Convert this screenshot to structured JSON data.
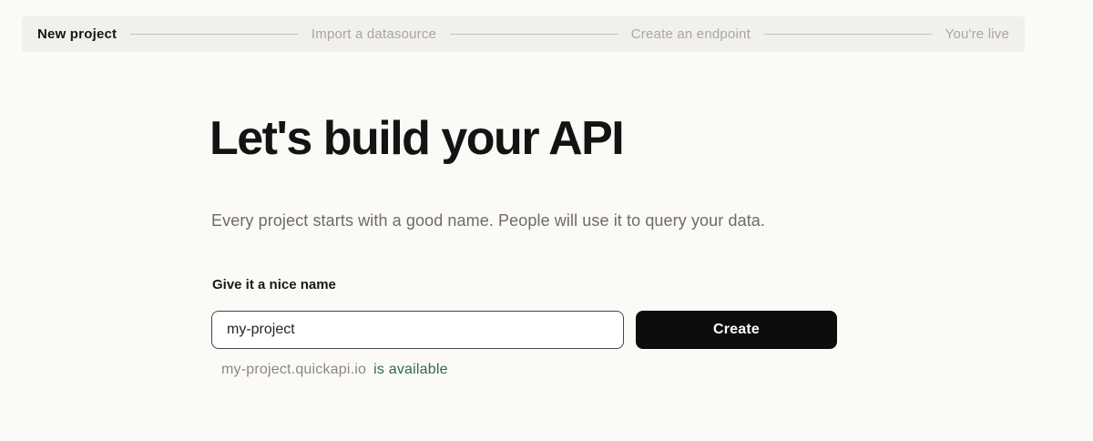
{
  "stepper": {
    "steps": [
      {
        "label": "New project",
        "active": true
      },
      {
        "label": "Import a datasource",
        "active": false
      },
      {
        "label": "Create an endpoint",
        "active": false
      },
      {
        "label": "You're live",
        "active": false
      }
    ]
  },
  "main": {
    "title": "Let's build your API",
    "subtitle": "Every project starts with a good name. People will use it to query your data.",
    "name_label": "Give it a nice name",
    "name_input": {
      "value": "my-project"
    },
    "create_button_label": "Create",
    "availability": {
      "domain": "my-project.quickapi.io",
      "status": "is available"
    }
  },
  "colors": {
    "page_background": "#fbfaf7",
    "stepper_background": "#f1f0ed",
    "stepper_inactive": "#a9a6a1",
    "stepper_active": "#161616",
    "button_background": "#0d0d0d",
    "availability_green": "#2e6b45"
  }
}
